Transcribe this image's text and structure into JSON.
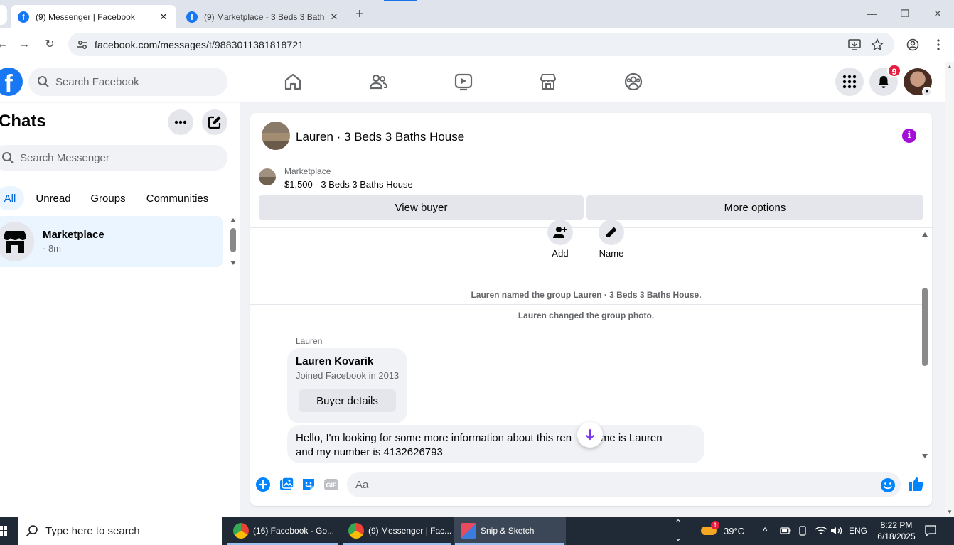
{
  "browser": {
    "tabs": [
      {
        "title": "(9) Messenger | Facebook",
        "close": "✕"
      },
      {
        "title": "(9) Marketplace - 3 Beds 3 Baths",
        "close": "✕"
      }
    ],
    "new_tab": "+",
    "url": "facebook.com/messages/t/9883011381818721"
  },
  "fb_nav": {
    "logo": "f",
    "search_placeholder": "Search Facebook",
    "notification_count": "9"
  },
  "chats": {
    "title": "Chats",
    "search_placeholder": "Search Messenger",
    "filters": [
      "All",
      "Unread",
      "Groups",
      "Communities"
    ],
    "items": [
      {
        "name": "Marketplace",
        "time": "· 8m"
      }
    ]
  },
  "conversation": {
    "title": "Lauren · 3 Beds 3 Baths House",
    "marketplace_label": "Marketplace",
    "listing": "$1,500 - 3 Beds 3 Baths House",
    "view_buyer": "View buyer",
    "more_options": "More options",
    "actions": [
      {
        "label": "Add"
      },
      {
        "label": "Name"
      }
    ],
    "system_messages": [
      "Lauren named the group Lauren · 3 Beds 3 Baths House.",
      "Lauren changed the group photo."
    ],
    "sender": "Lauren",
    "card": {
      "name": "Lauren Kovarik",
      "subtitle": "Joined Facebook in 2013",
      "button": "Buyer details"
    },
    "message_line1": "Hello, I'm looking for some more information about this ren   y name is Lauren",
    "message_line2": "and my number is 4132626793",
    "composer_placeholder": "Aa"
  },
  "taskbar": {
    "search_placeholder": "Type here to search",
    "apps": [
      {
        "label": "(16) Facebook - Go..."
      },
      {
        "label": "(9) Messenger | Fac..."
      },
      {
        "label": "Snip & Sketch"
      }
    ],
    "weather_badge": "1",
    "temperature": "39°C",
    "language": "ENG",
    "time": "8:22 PM",
    "date": "6/18/2025"
  },
  "colors": {
    "fb_blue": "#1877f2",
    "messenger_blue": "#0084ff",
    "info_purple": "#a30fd7",
    "badge_red": "#e41e3f"
  }
}
